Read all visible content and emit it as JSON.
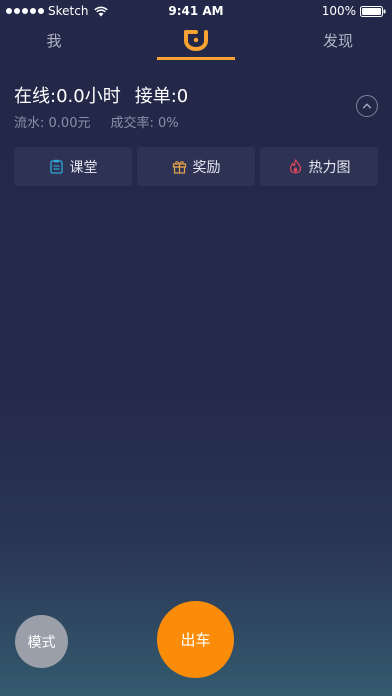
{
  "status_bar": {
    "carrier": "Sketch",
    "time": "9:41 AM",
    "battery": "100%",
    "icons": [
      "signal-dots-icon",
      "wifi-icon",
      "battery-icon"
    ]
  },
  "tabs": {
    "me": "我",
    "home_icon": "didi-logo-icon",
    "discover": "发现"
  },
  "stats": {
    "online_label": "在线:",
    "online_value": "0.0小时",
    "orders_label": "接单:",
    "orders_value": "0",
    "flow_label": "流水:",
    "flow_value": "0.00元",
    "rate_label": "成交率:",
    "rate_value": "0%",
    "collapse_icon": "chevron-up-icon"
  },
  "quick_actions": [
    {
      "label": "课堂",
      "icon": "clipboard-icon",
      "color": "#2fa7d8"
    },
    {
      "label": "奖励",
      "icon": "gift-icon",
      "color": "#e7a44a"
    },
    {
      "label": "热力图",
      "icon": "flame-icon",
      "color": "#e0485c"
    }
  ],
  "bottom": {
    "mode_label": "模式",
    "go_label": "出车"
  },
  "colors": {
    "accent": "#fb8c0a",
    "tab_indicator": "#f7a233",
    "background": "#232849"
  }
}
